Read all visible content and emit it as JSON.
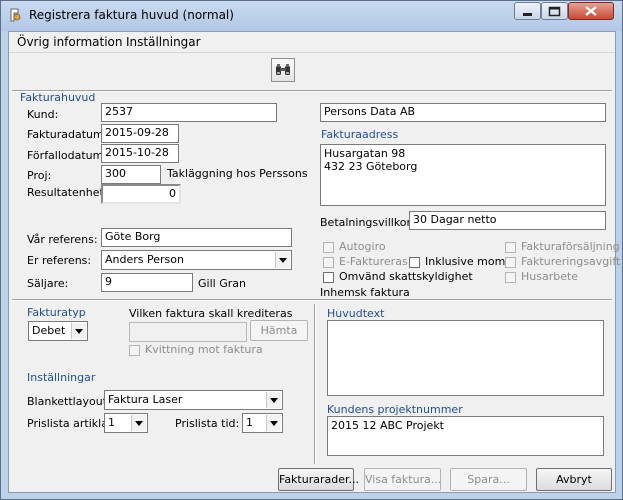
{
  "window": {
    "title": "Registrera faktura huvud (normal)",
    "icon": "app-icon",
    "controls": [
      "minimize-icon",
      "maximize-icon",
      "close-icon"
    ],
    "accent": "#1f4e9b"
  },
  "menu": {
    "items": [
      "Övrig information",
      "Inställningar"
    ]
  },
  "toolbar": {
    "search_icon": "binoculars-icon"
  },
  "header_group": {
    "title": "Fakturahuvud",
    "kund_label": "Kund:",
    "kund_value": "2537",
    "kund_name": "Persons Data AB",
    "fakturadatum_label": "Fakturadatum:",
    "fakturadatum_value": "2015-09-28",
    "forfallodatum_label": "Förfallodatum:",
    "forfallodatum_value": "2015-10-28",
    "proj_label": "Proj:",
    "proj_value": "300",
    "proj_name": "Takläggning hos Perssons",
    "resultatenhet_label": "Resultatenhet:",
    "resultatenhet_value": "0",
    "var_referens_label": "Vår referens:",
    "var_referens_value": "Göte Borg",
    "er_referens_label": "Er referens:",
    "er_referens_value": "Anders Person",
    "saljare_label": "Säljare:",
    "saljare_value": "9",
    "saljare_name": "Gill Gran"
  },
  "address": {
    "label": "Fakturaadress",
    "value": "Husargatan 98\n432 23 Göteborg"
  },
  "payment": {
    "label": "Betalningsvillkor:",
    "value": "30 Dagar netto"
  },
  "checkboxes": {
    "autogiro": "Autogiro",
    "efaktureras": "E-Faktureras",
    "inklusive_moms": "Inklusive moms",
    "omvand": "Omvänd skattskyldighet",
    "fakturaforsaljning": "Fakturaförsäljning",
    "faktureringsavgift": "Faktureringsavgift",
    "husarbete": "Husarbete",
    "inhemsk": "Inhemsk faktura"
  },
  "fakturatyp": {
    "label": "Fakturatyp",
    "value": "Debet",
    "kreditera_label": "Vilken faktura skall krediteras",
    "kreditera_value": "",
    "hamta_button": "Hämta",
    "kvittning_label": "Kvittning mot faktura"
  },
  "installningar": {
    "label": "Inställningar",
    "blankett_label": "Blankettlayout:",
    "blankett_value": "Faktura Laser",
    "prislista_artiklar_label": "Prislista artiklar:",
    "prislista_artiklar_value": "1",
    "prislista_tid_label": "Prislista tid:",
    "prislista_tid_value": "1"
  },
  "huvudtext": {
    "label": "Huvudtext",
    "value": ""
  },
  "projekt": {
    "label": "Kundens projektnummer",
    "value": "2015 12 ABC Projekt"
  },
  "buttons": {
    "fakturarader": "Fakturarader...",
    "visa_faktura": "Visa faktura...",
    "spara": "Spara...",
    "avbryt": "Avbryt"
  }
}
